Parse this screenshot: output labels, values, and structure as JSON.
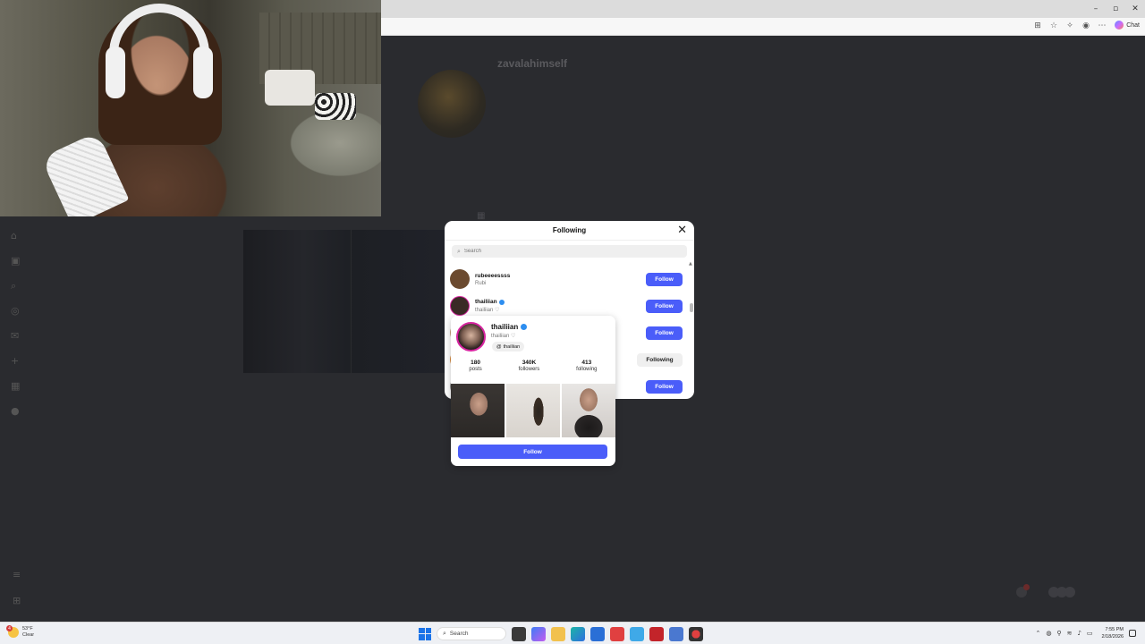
{
  "browser": {
    "window_controls": [
      "–",
      "▫",
      "✕"
    ],
    "toolbar_icons": [
      "⊞",
      "☆",
      "✧",
      "◉",
      "⋯"
    ],
    "chat_label": "Chat"
  },
  "profile": {
    "username": "zavalahimself",
    "subtitle": "",
    "stats": [
      "",
      "",
      ""
    ],
    "bio_lines": [
      "",
      "",
      "",
      ""
    ],
    "mutuals_text": "",
    "tabs": [
      "",
      "",
      ""
    ]
  },
  "following_modal": {
    "title": "Following",
    "search_placeholder": "Search",
    "rows": [
      {
        "username": "rubeeeessss",
        "name": "Rubi",
        "verified": false,
        "button": "Follow",
        "avatar_color": "#6b4a2f"
      },
      {
        "username": "thailiian",
        "name": "thailiian ♡",
        "verified": true,
        "button": "Follow",
        "avatar_color": "#3a2a26"
      },
      {
        "username": "",
        "name": "",
        "verified": false,
        "button": "Follow",
        "avatar_color": "#c9a57b"
      },
      {
        "username": "",
        "name": "",
        "verified": false,
        "button": "Following",
        "avatar_color": "#d98a3b"
      },
      {
        "username": "",
        "name": "",
        "verified": false,
        "button": "Follow",
        "avatar_color": "#999999"
      }
    ]
  },
  "hover_card": {
    "username": "thailiian",
    "full_name": "thailiian ♡",
    "threads_label": "thailiian",
    "stats": [
      {
        "value": "180",
        "label": "posts"
      },
      {
        "value": "340K",
        "label": "followers"
      },
      {
        "value": "413",
        "label": "following"
      }
    ],
    "follow_label": "Follow"
  },
  "taskbar": {
    "weather_badge": "4",
    "temperature": "53°F",
    "condition": "Clear",
    "search_label": "Search",
    "time": "7:55 PM",
    "date": "2/18/2026"
  },
  "colors": {
    "primary_button": "#4a5df9",
    "verified": "#2d8ef0",
    "page_dim": "#2a2b2f"
  }
}
